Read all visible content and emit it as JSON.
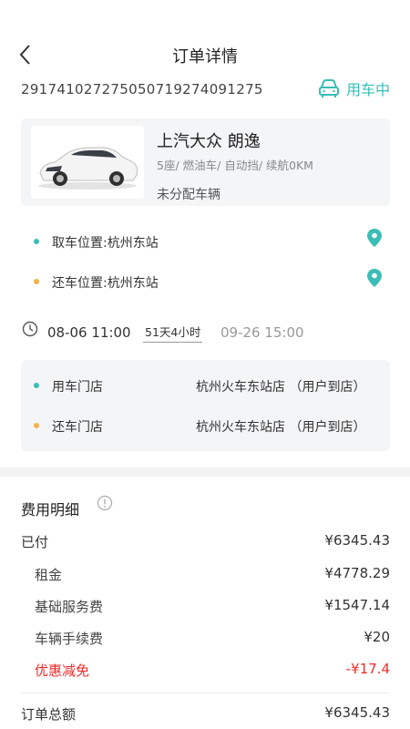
{
  "header": {
    "title": "订单详情"
  },
  "order": {
    "number": "29174102727505071927409127 5",
    "status": "用车中"
  },
  "car": {
    "name": "上汽大众 朗逸",
    "spec": "5座/ 燃油车/ 自动挡/ 续航0KM",
    "assignment": "未分配车辆"
  },
  "locations": {
    "pickup": "取车位置:杭州东站",
    "return": "还车位置:杭州东站"
  },
  "time": {
    "start": "08-06 11:00",
    "duration": "51天4小时",
    "end": "09-26 15:00"
  },
  "stores": {
    "use_label": "用车门店",
    "use_value": "杭州火车东站店 （用户到店）",
    "return_label": "还车门店",
    "return_value": "杭州火车东站店 （用户到店）"
  },
  "fees": {
    "title": "费用明细",
    "paid_label": "已付",
    "paid_value": "¥6345.43",
    "items": [
      {
        "label": "租金",
        "value": "¥4778.29"
      },
      {
        "label": "基础服务费",
        "value": "¥1547.14"
      },
      {
        "label": "车辆手续费",
        "value": "¥20"
      }
    ],
    "discount_label": "优惠减免",
    "discount_value": "-¥17.4",
    "total_label": "订单总额",
    "total_value": "¥6345.43"
  },
  "colors": {
    "accent": "#3bbdb7",
    "pickup_dot": "#3bbdb7",
    "return_dot": "#f3b24a",
    "discount": "#f02b2b"
  },
  "icons": {
    "back": "chevron-left-icon",
    "status": "car-icon",
    "pin": "location-pin-icon",
    "clock": "clock-icon",
    "info": "info-circle-icon"
  }
}
